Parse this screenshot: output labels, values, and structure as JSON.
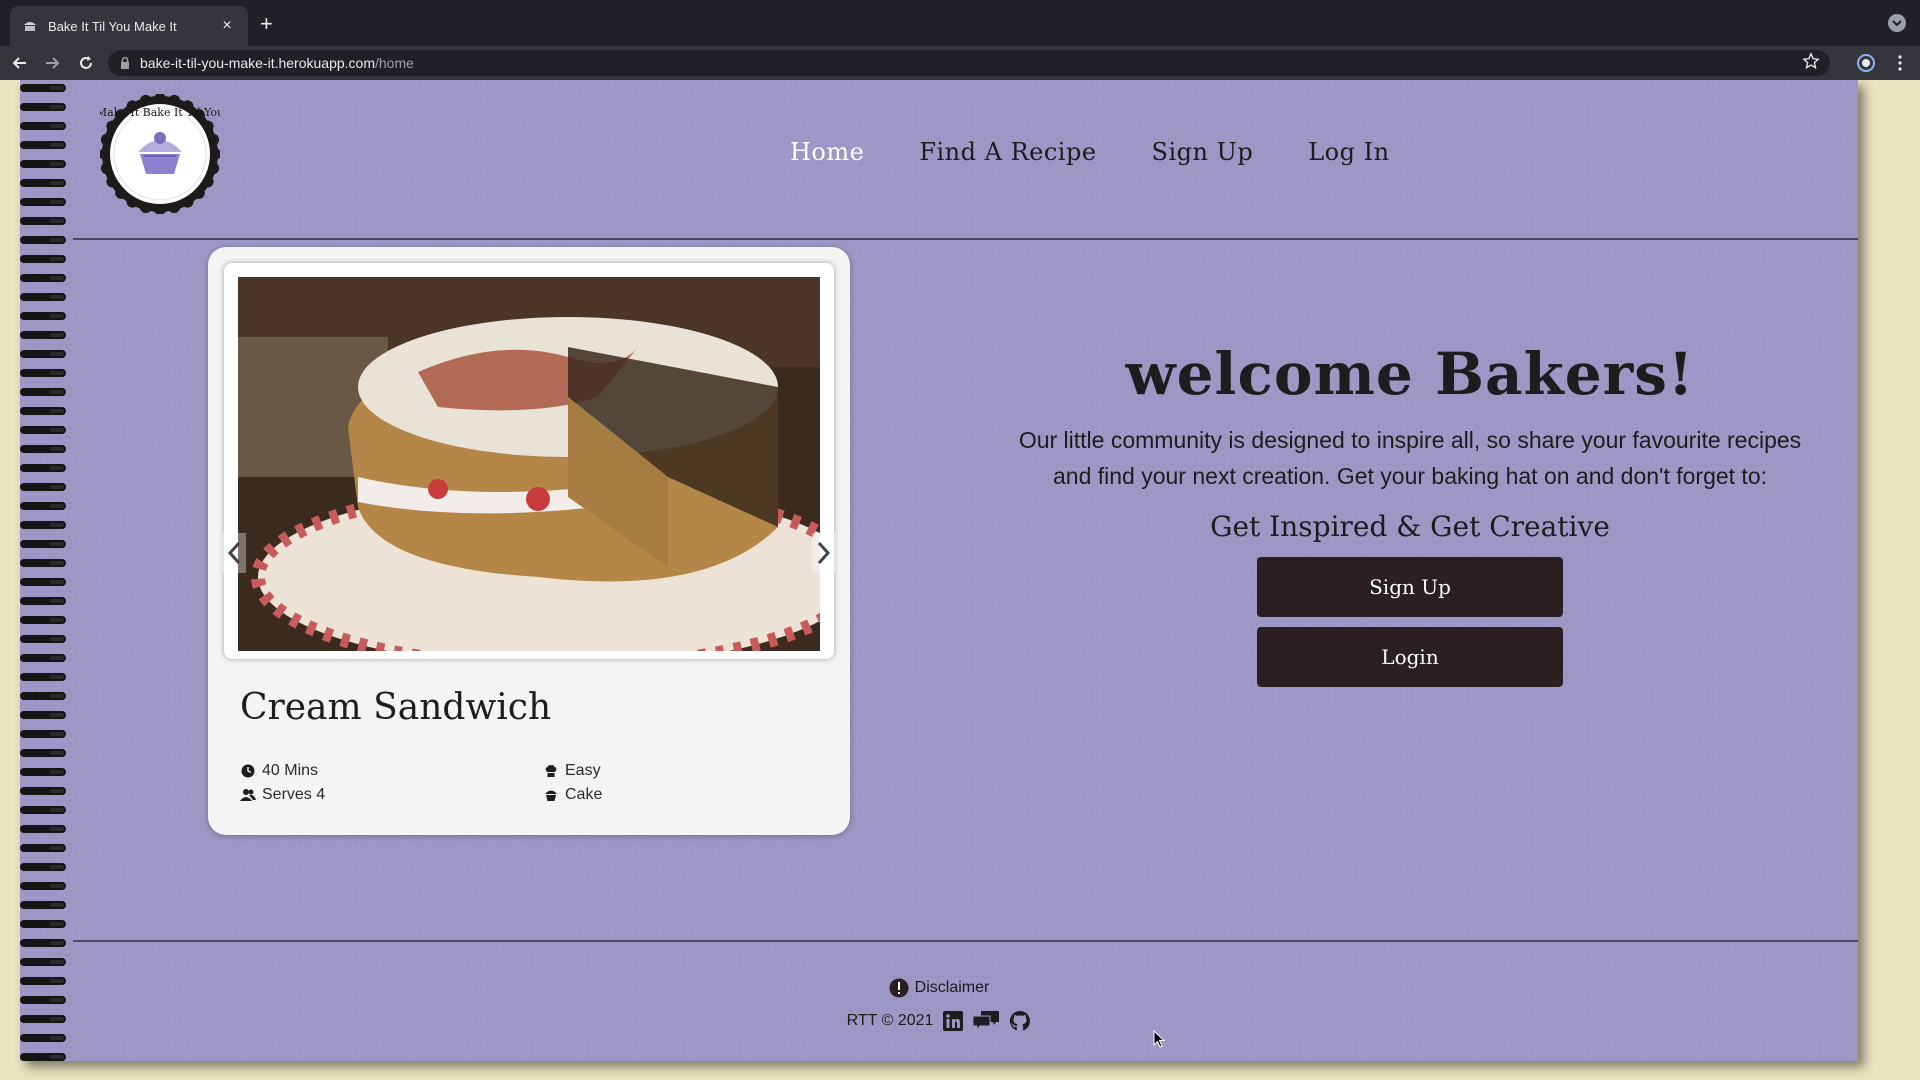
{
  "browser": {
    "tab_title": "Bake It Til You Make It",
    "tab_close": "×",
    "new_tab": "+",
    "url_host": "bake-it-til-you-make-it.herokuapp.com",
    "url_path": "/home"
  },
  "site": {
    "logo_text": "Make It Bake It Til You",
    "nav": [
      {
        "label": "Home",
        "active": true
      },
      {
        "label": "Find A Recipe"
      },
      {
        "label": "Sign Up"
      },
      {
        "label": "Log In"
      }
    ]
  },
  "carousel": {
    "recipe_title": "Cream Sandwich",
    "time": "40 Mins",
    "difficulty": "Easy",
    "serves": "Serves 4",
    "category": "Cake"
  },
  "welcome": {
    "title": "welcome Bakers!",
    "body": "Our little community is designed to inspire all, so share your favourite recipes and find your next creation. Get your baking hat on and don't forget to:",
    "tagline": "Get Inspired & Get Creative",
    "signup_label": "Sign Up",
    "login_label": "Login"
  },
  "footer": {
    "disclaimer": "Disclaimer",
    "copyright": "RTT © 2021"
  },
  "colors": {
    "page_bg": "#9c97c4",
    "button_bg": "#2c1f22",
    "chrome_dark": "#202124",
    "chrome_toolbar": "#35363a"
  },
  "icons": [
    "cupcake-favicon-icon",
    "back-icon",
    "forward-icon",
    "reload-icon",
    "lock-icon",
    "star-icon",
    "profile-icon",
    "menu-icon",
    "clock-icon",
    "chef-hat-icon",
    "people-icon",
    "cupcake-icon",
    "alert-icon",
    "linkedin-icon",
    "chat-icon",
    "github-icon"
  ]
}
